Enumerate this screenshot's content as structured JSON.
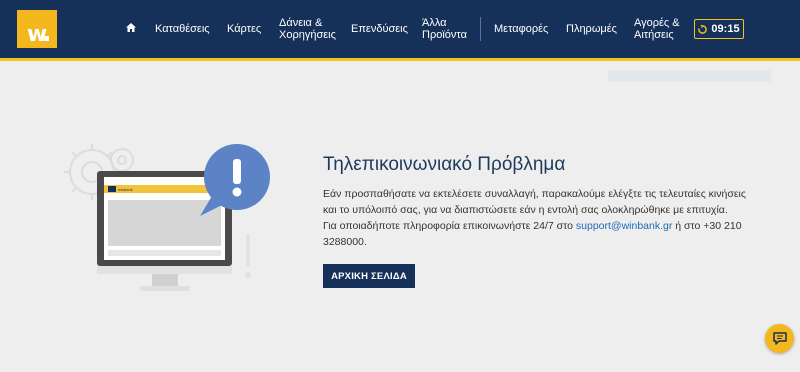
{
  "header": {
    "logo_letter": "w",
    "nav": [
      {
        "label": "Καταθέσεις"
      },
      {
        "label": "Κάρτες"
      },
      {
        "label_line1": "Δάνεια &",
        "label_line2": "Χορηγήσεις"
      },
      {
        "label": "Επενδύσεις"
      },
      {
        "label_line1": "Άλλα",
        "label_line2": "Προϊόντα"
      },
      {
        "label": "Μεταφορές"
      },
      {
        "label": "Πληρωμές"
      },
      {
        "label_line1": "Αγορές &",
        "label_line2": "Αιτήσεις"
      }
    ],
    "timer": "09:15",
    "accent_color": "#f4c21b",
    "bar_color": "#15315a"
  },
  "illustration": {
    "screen_brand": "winbank",
    "icon": "exclamation-bubble-icon"
  },
  "error": {
    "title": "Τηλεπικοινωνιακό Πρόβλημα",
    "line1": "Εάν προσπαθήσατε να εκτελέσετε συναλλαγή, παρακαλούμε ελέγξτε τις τελευταίες κινήσεις",
    "line2": "και το υπόλοιπό σας, για να διαπιστώσετε εάν η εντολή σας ολοκληρώθηκε με επιτυχία.",
    "line3_prefix": "Για οποιαδήποτε πληροφορία επικοινωνήστε 24/7 στο ",
    "email": "support@winbank.gr",
    "line3_suffix": " ή στο +30 210",
    "line4": "3288000.",
    "button_label": "ΑΡΧΙΚΗ ΣΕΛΙΔΑ"
  }
}
